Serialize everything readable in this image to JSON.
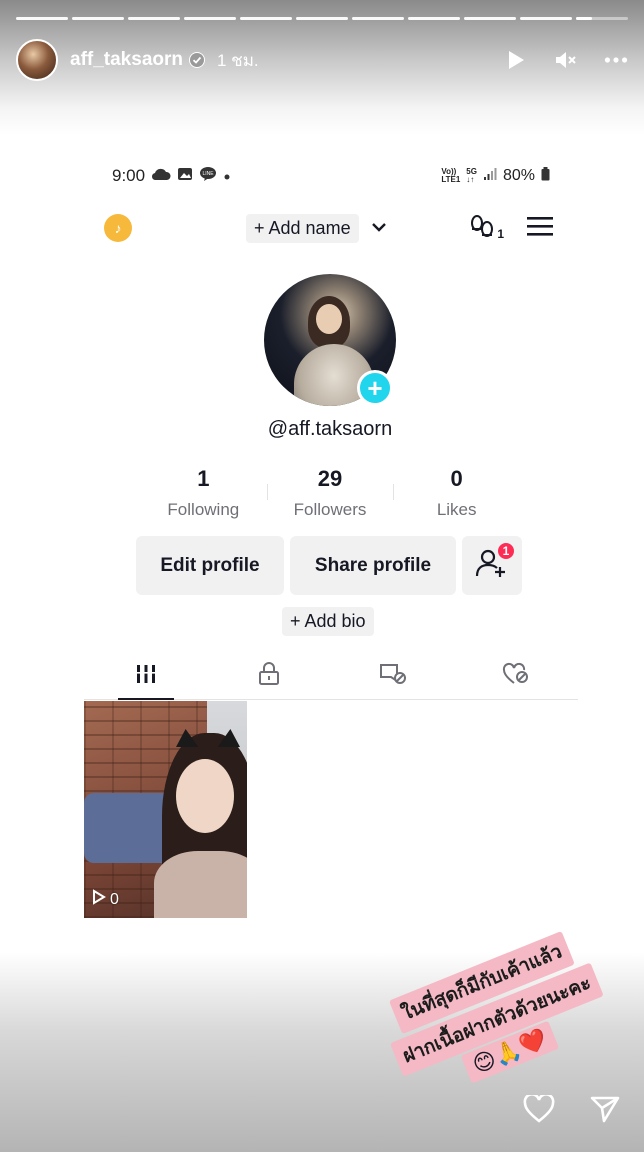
{
  "story": {
    "username": "aff_taksaorn",
    "time_ago": "1 ชม.",
    "progress_segments": 11,
    "controls": {
      "play_icon": "play-icon",
      "mute_icon": "speaker-muted-icon",
      "more_icon": "more-dots-icon"
    }
  },
  "phone_status": {
    "time": "9:00",
    "net1": "Vo))\nLTE1",
    "net2": "5G\n↓↑",
    "battery": "80%"
  },
  "profile": {
    "add_name": "+ Add name",
    "handle": "@aff.taksaorn",
    "stats": [
      {
        "value": "1",
        "label": "Following"
      },
      {
        "value": "29",
        "label": "Followers"
      },
      {
        "value": "0",
        "label": "Likes"
      }
    ],
    "edit_profile": "Edit profile",
    "share_profile": "Share profile",
    "friend_badge": "1",
    "add_bio": "+ Add bio",
    "footprint_count": "1"
  },
  "video": {
    "views": "0"
  },
  "sticker": {
    "line1": "ในที่สุดก็มีกับเค้าแล้ว",
    "line2": "ฝากเนื้อฝากตัวด้วยนะคะ",
    "emojis": "😊🙏❤️"
  },
  "colors": {
    "accent": "#20d5ec",
    "badge": "#fe2c55",
    "coin": "#f6b93b",
    "sticker_bg": "#f4b9c4"
  }
}
